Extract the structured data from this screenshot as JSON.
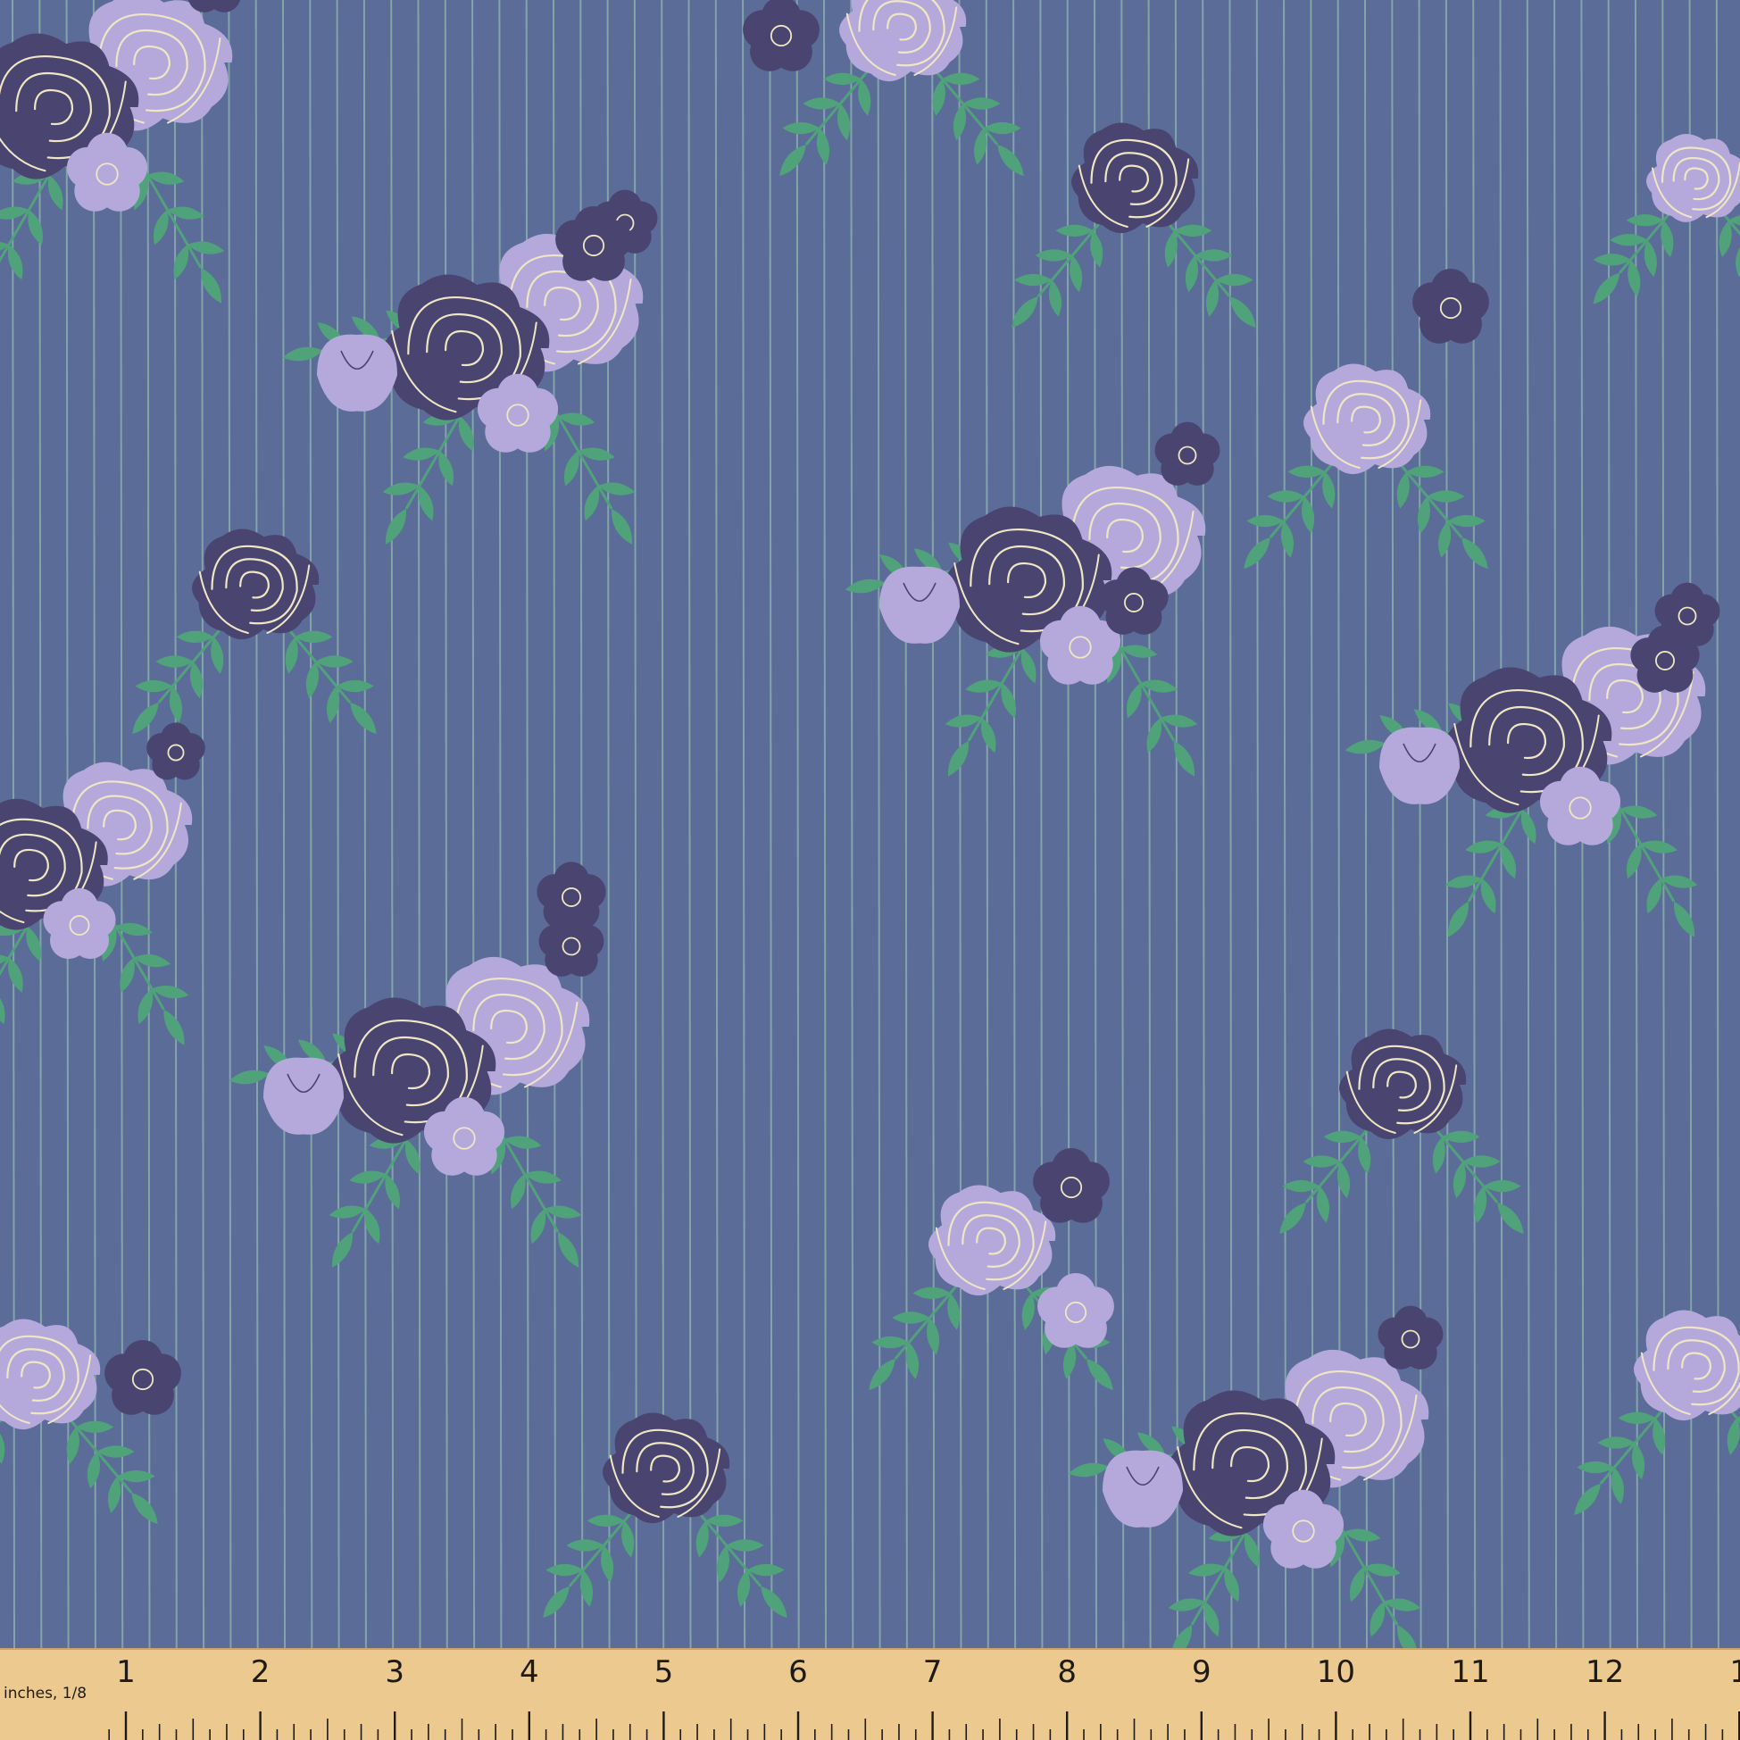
{
  "fabric": {
    "pattern": "roses-on-pinstripe",
    "background_color": "#5b6c98",
    "stripe_color": "#8fb8b0",
    "dark_rose_color": "#4a4470",
    "light_rose_color": "#b5a9dc",
    "rose_outline_color": "#efe6c4",
    "leaf_color": "#4fa27a"
  },
  "ruler": {
    "unit_label": "inches, 1/8",
    "numbers": [
      "1",
      "2",
      "3",
      "4",
      "5",
      "6",
      "7",
      "8",
      "9",
      "10",
      "11",
      "12",
      "1"
    ],
    "wood_color": "#ecca8f",
    "ink_color": "#1e1a16"
  }
}
